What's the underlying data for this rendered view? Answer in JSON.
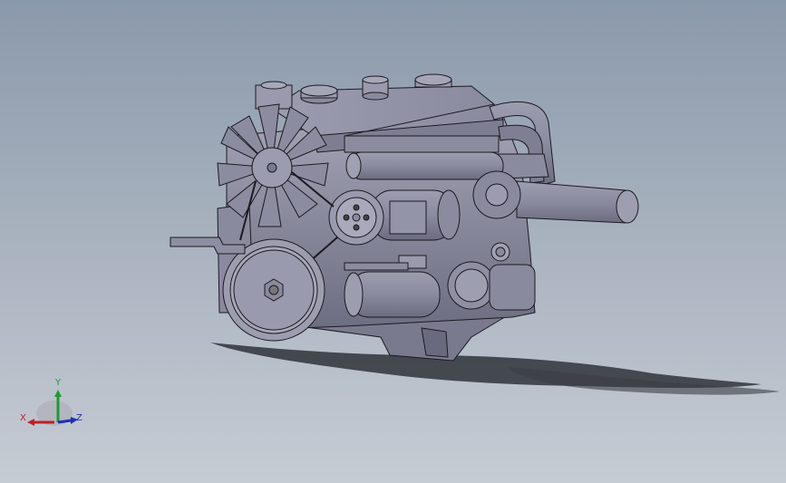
{
  "viewport": {
    "background_top": "#8a99ab",
    "background_bottom": "#c6ccd4",
    "model_color": "#8e8ea3",
    "edge_color": "#1a1a22"
  },
  "triad": {
    "x_label": "X",
    "y_label": "Y",
    "z_label": "Z",
    "x_color": "#c0202a",
    "y_color": "#1e9a2e",
    "z_color": "#1e2fb8"
  }
}
